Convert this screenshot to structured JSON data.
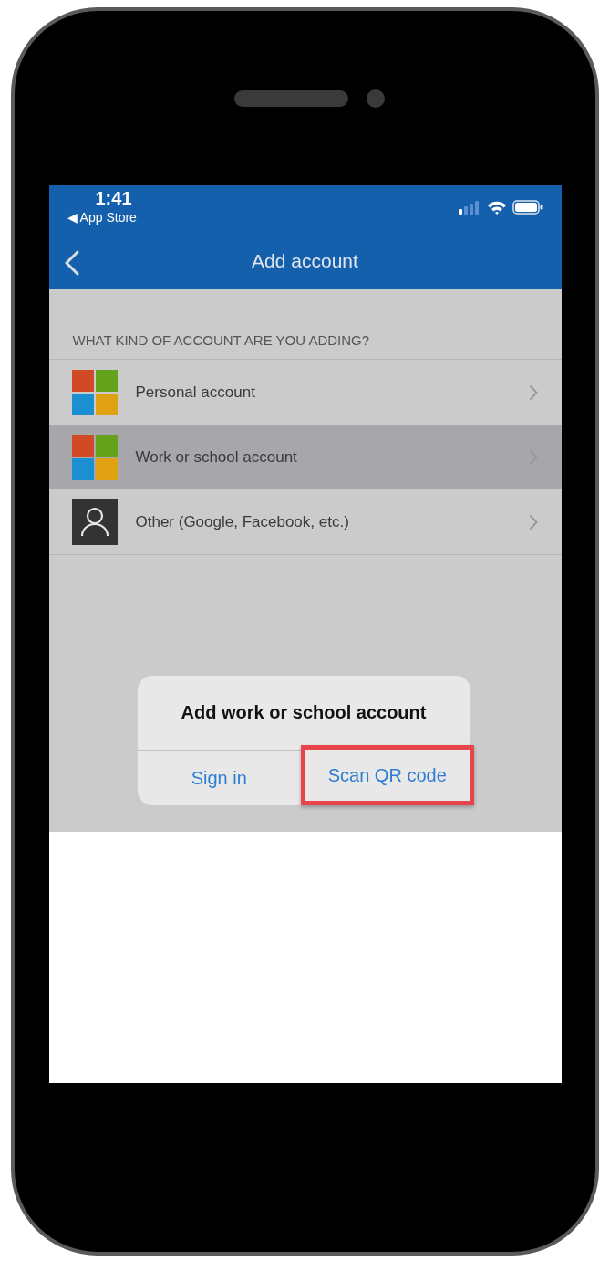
{
  "status_bar": {
    "time": "1:41",
    "back_app": "◀ App Store"
  },
  "nav_bar": {
    "title": "Add account"
  },
  "section_header": "WHAT KIND OF ACCOUNT ARE YOU ADDING?",
  "account_types": [
    {
      "label": "Personal account",
      "kind": "microsoft",
      "selected": false
    },
    {
      "label": "Work or school account",
      "kind": "microsoft",
      "selected": true
    },
    {
      "label": "Other (Google, Facebook, etc.)",
      "kind": "person",
      "selected": false
    }
  ],
  "dialog": {
    "title": "Add work or school account",
    "actions": [
      {
        "label": "Sign in",
        "highlighted": false
      },
      {
        "label": "Scan QR code",
        "highlighted": true
      }
    ]
  }
}
